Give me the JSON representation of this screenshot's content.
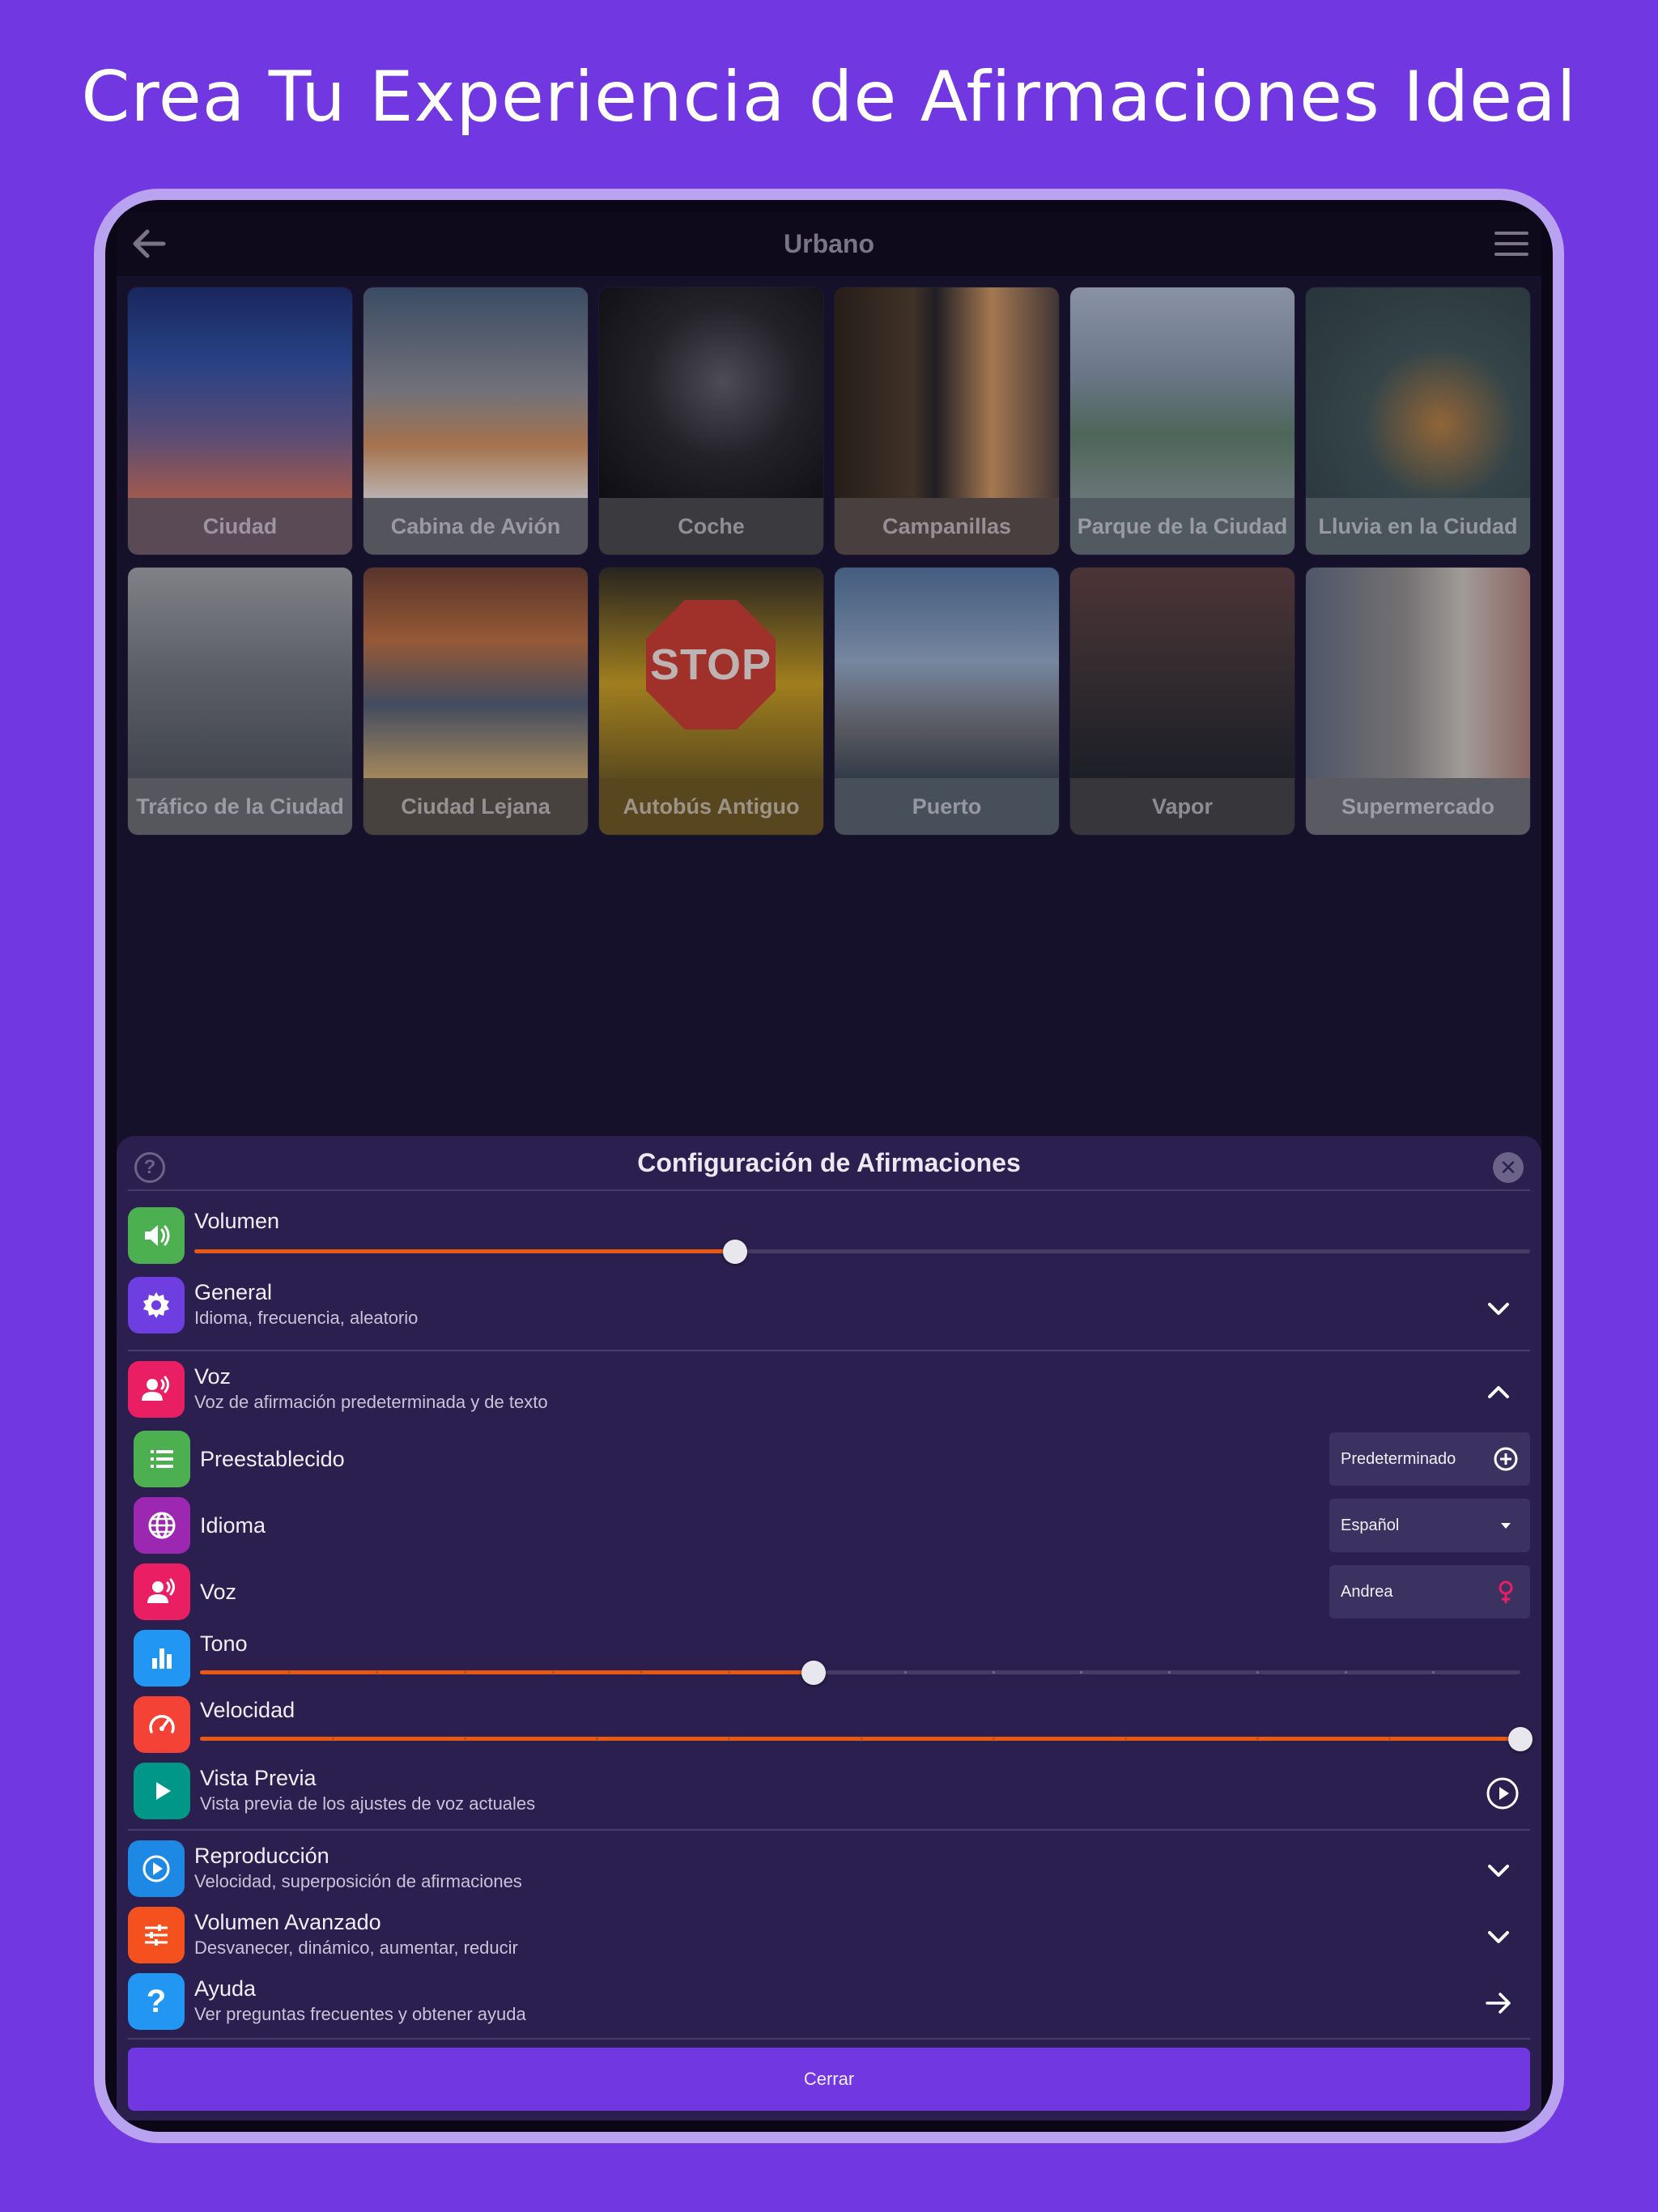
{
  "headline": "Crea Tu Experiencia de Afirmaciones Ideal",
  "topbar": {
    "title": "Urbano",
    "back_icon": "arrow-left-icon",
    "menu_icon": "hamburger-menu-icon"
  },
  "sounds": [
    {
      "label": "Ciudad"
    },
    {
      "label": "Cabina de Avión"
    },
    {
      "label": "Coche"
    },
    {
      "label": "Campanillas"
    },
    {
      "label": "Parque de la Ciudad"
    },
    {
      "label": "Lluvia en la Ciudad"
    },
    {
      "label": "Tráfico de la Ciudad"
    },
    {
      "label": "Ciudad Lejana"
    },
    {
      "label": "Autobús Antiguo",
      "sign_text": "STOP"
    },
    {
      "label": "Puerto"
    },
    {
      "label": "Vapor"
    },
    {
      "label": "Supermercado"
    }
  ],
  "settings": {
    "title": "Configuración de Afirmaciones",
    "help_glyph": "?",
    "close_glyph": "✕",
    "volume": {
      "label": "Volumen",
      "value": 0.405,
      "icon": "speaker-icon",
      "color": "#4caf50"
    },
    "general": {
      "label": "General",
      "subtitle": "Idioma, frecuencia, aleatorio",
      "icon": "gear-icon",
      "color": "#6f3ee0"
    },
    "voice_section": {
      "label": "Voz",
      "subtitle": "Voz de afirmación predeterminada y de texto",
      "icon": "speaking-person-icon",
      "color": "#e91e63"
    },
    "preset": {
      "label": "Preestablecido",
      "value": "Predeterminado",
      "icon": "list-icon",
      "color": "#4caf50"
    },
    "language": {
      "label": "Idioma",
      "value": "Español",
      "icon": "globe-icon",
      "color": "#9c27b0"
    },
    "voice": {
      "label": "Voz",
      "value": "Andrea",
      "icon": "speaking-person-icon",
      "color": "#e91e63"
    },
    "pitch": {
      "label": "Tono",
      "value": 0.465,
      "icon": "bar-chart-icon",
      "color": "#2196f3"
    },
    "speed": {
      "label": "Velocidad",
      "value": 1.0,
      "icon": "speedometer-icon",
      "color": "#f44336"
    },
    "preview": {
      "label": "Vista Previa",
      "subtitle": "Vista previa de los ajustes de voz actuales",
      "icon": "play-icon",
      "color": "#009688"
    },
    "playback": {
      "label": "Reproducción",
      "subtitle": "Velocidad, superposición de afirmaciones",
      "icon": "play-circle-icon",
      "color": "#1e88e5"
    },
    "advanced_volume": {
      "label": "Volumen Avanzado",
      "subtitle": "Desvanecer, dinámico, aumentar, reducir",
      "icon": "sliders-icon",
      "color": "#f4511e"
    },
    "help": {
      "label": "Ayuda",
      "subtitle": "Ver preguntas frecuentes y obtener ayuda",
      "icon": "question-icon",
      "color": "#2196f3"
    },
    "close_button": "Cerrar",
    "accent": "#e85a12"
  }
}
